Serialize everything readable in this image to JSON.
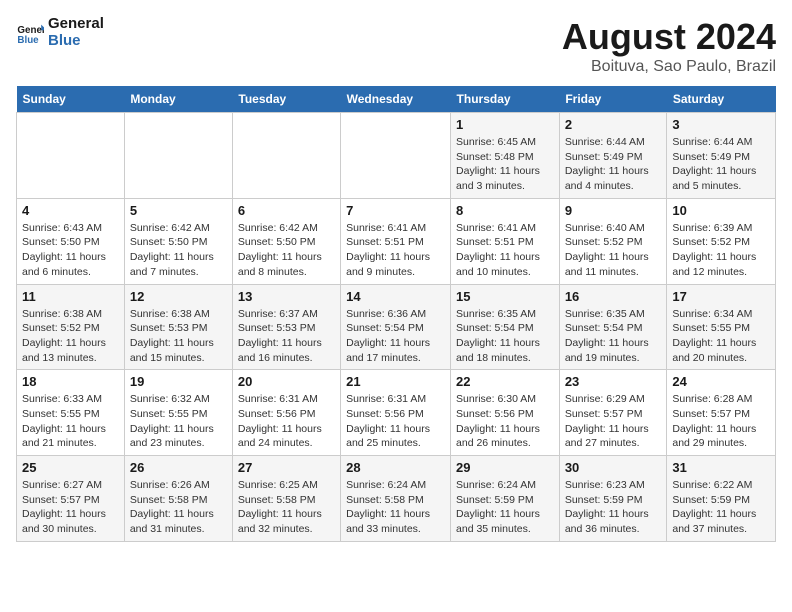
{
  "logo": {
    "line1": "General",
    "line2": "Blue"
  },
  "title": "August 2024",
  "subtitle": "Boituva, Sao Paulo, Brazil",
  "weekdays": [
    "Sunday",
    "Monday",
    "Tuesday",
    "Wednesday",
    "Thursday",
    "Friday",
    "Saturday"
  ],
  "weeks": [
    [
      {
        "day": "",
        "sunrise": "",
        "sunset": "",
        "daylight": ""
      },
      {
        "day": "",
        "sunrise": "",
        "sunset": "",
        "daylight": ""
      },
      {
        "day": "",
        "sunrise": "",
        "sunset": "",
        "daylight": ""
      },
      {
        "day": "",
        "sunrise": "",
        "sunset": "",
        "daylight": ""
      },
      {
        "day": "1",
        "sunrise": "Sunrise: 6:45 AM",
        "sunset": "Sunset: 5:48 PM",
        "daylight": "Daylight: 11 hours and 3 minutes."
      },
      {
        "day": "2",
        "sunrise": "Sunrise: 6:44 AM",
        "sunset": "Sunset: 5:49 PM",
        "daylight": "Daylight: 11 hours and 4 minutes."
      },
      {
        "day": "3",
        "sunrise": "Sunrise: 6:44 AM",
        "sunset": "Sunset: 5:49 PM",
        "daylight": "Daylight: 11 hours and 5 minutes."
      }
    ],
    [
      {
        "day": "4",
        "sunrise": "Sunrise: 6:43 AM",
        "sunset": "Sunset: 5:50 PM",
        "daylight": "Daylight: 11 hours and 6 minutes."
      },
      {
        "day": "5",
        "sunrise": "Sunrise: 6:42 AM",
        "sunset": "Sunset: 5:50 PM",
        "daylight": "Daylight: 11 hours and 7 minutes."
      },
      {
        "day": "6",
        "sunrise": "Sunrise: 6:42 AM",
        "sunset": "Sunset: 5:50 PM",
        "daylight": "Daylight: 11 hours and 8 minutes."
      },
      {
        "day": "7",
        "sunrise": "Sunrise: 6:41 AM",
        "sunset": "Sunset: 5:51 PM",
        "daylight": "Daylight: 11 hours and 9 minutes."
      },
      {
        "day": "8",
        "sunrise": "Sunrise: 6:41 AM",
        "sunset": "Sunset: 5:51 PM",
        "daylight": "Daylight: 11 hours and 10 minutes."
      },
      {
        "day": "9",
        "sunrise": "Sunrise: 6:40 AM",
        "sunset": "Sunset: 5:52 PM",
        "daylight": "Daylight: 11 hours and 11 minutes."
      },
      {
        "day": "10",
        "sunrise": "Sunrise: 6:39 AM",
        "sunset": "Sunset: 5:52 PM",
        "daylight": "Daylight: 11 hours and 12 minutes."
      }
    ],
    [
      {
        "day": "11",
        "sunrise": "Sunrise: 6:38 AM",
        "sunset": "Sunset: 5:52 PM",
        "daylight": "Daylight: 11 hours and 13 minutes."
      },
      {
        "day": "12",
        "sunrise": "Sunrise: 6:38 AM",
        "sunset": "Sunset: 5:53 PM",
        "daylight": "Daylight: 11 hours and 15 minutes."
      },
      {
        "day": "13",
        "sunrise": "Sunrise: 6:37 AM",
        "sunset": "Sunset: 5:53 PM",
        "daylight": "Daylight: 11 hours and 16 minutes."
      },
      {
        "day": "14",
        "sunrise": "Sunrise: 6:36 AM",
        "sunset": "Sunset: 5:54 PM",
        "daylight": "Daylight: 11 hours and 17 minutes."
      },
      {
        "day": "15",
        "sunrise": "Sunrise: 6:35 AM",
        "sunset": "Sunset: 5:54 PM",
        "daylight": "Daylight: 11 hours and 18 minutes."
      },
      {
        "day": "16",
        "sunrise": "Sunrise: 6:35 AM",
        "sunset": "Sunset: 5:54 PM",
        "daylight": "Daylight: 11 hours and 19 minutes."
      },
      {
        "day": "17",
        "sunrise": "Sunrise: 6:34 AM",
        "sunset": "Sunset: 5:55 PM",
        "daylight": "Daylight: 11 hours and 20 minutes."
      }
    ],
    [
      {
        "day": "18",
        "sunrise": "Sunrise: 6:33 AM",
        "sunset": "Sunset: 5:55 PM",
        "daylight": "Daylight: 11 hours and 21 minutes."
      },
      {
        "day": "19",
        "sunrise": "Sunrise: 6:32 AM",
        "sunset": "Sunset: 5:55 PM",
        "daylight": "Daylight: 11 hours and 23 minutes."
      },
      {
        "day": "20",
        "sunrise": "Sunrise: 6:31 AM",
        "sunset": "Sunset: 5:56 PM",
        "daylight": "Daylight: 11 hours and 24 minutes."
      },
      {
        "day": "21",
        "sunrise": "Sunrise: 6:31 AM",
        "sunset": "Sunset: 5:56 PM",
        "daylight": "Daylight: 11 hours and 25 minutes."
      },
      {
        "day": "22",
        "sunrise": "Sunrise: 6:30 AM",
        "sunset": "Sunset: 5:56 PM",
        "daylight": "Daylight: 11 hours and 26 minutes."
      },
      {
        "day": "23",
        "sunrise": "Sunrise: 6:29 AM",
        "sunset": "Sunset: 5:57 PM",
        "daylight": "Daylight: 11 hours and 27 minutes."
      },
      {
        "day": "24",
        "sunrise": "Sunrise: 6:28 AM",
        "sunset": "Sunset: 5:57 PM",
        "daylight": "Daylight: 11 hours and 29 minutes."
      }
    ],
    [
      {
        "day": "25",
        "sunrise": "Sunrise: 6:27 AM",
        "sunset": "Sunset: 5:57 PM",
        "daylight": "Daylight: 11 hours and 30 minutes."
      },
      {
        "day": "26",
        "sunrise": "Sunrise: 6:26 AM",
        "sunset": "Sunset: 5:58 PM",
        "daylight": "Daylight: 11 hours and 31 minutes."
      },
      {
        "day": "27",
        "sunrise": "Sunrise: 6:25 AM",
        "sunset": "Sunset: 5:58 PM",
        "daylight": "Daylight: 11 hours and 32 minutes."
      },
      {
        "day": "28",
        "sunrise": "Sunrise: 6:24 AM",
        "sunset": "Sunset: 5:58 PM",
        "daylight": "Daylight: 11 hours and 33 minutes."
      },
      {
        "day": "29",
        "sunrise": "Sunrise: 6:24 AM",
        "sunset": "Sunset: 5:59 PM",
        "daylight": "Daylight: 11 hours and 35 minutes."
      },
      {
        "day": "30",
        "sunrise": "Sunrise: 6:23 AM",
        "sunset": "Sunset: 5:59 PM",
        "daylight": "Daylight: 11 hours and 36 minutes."
      },
      {
        "day": "31",
        "sunrise": "Sunrise: 6:22 AM",
        "sunset": "Sunset: 5:59 PM",
        "daylight": "Daylight: 11 hours and 37 minutes."
      }
    ]
  ]
}
